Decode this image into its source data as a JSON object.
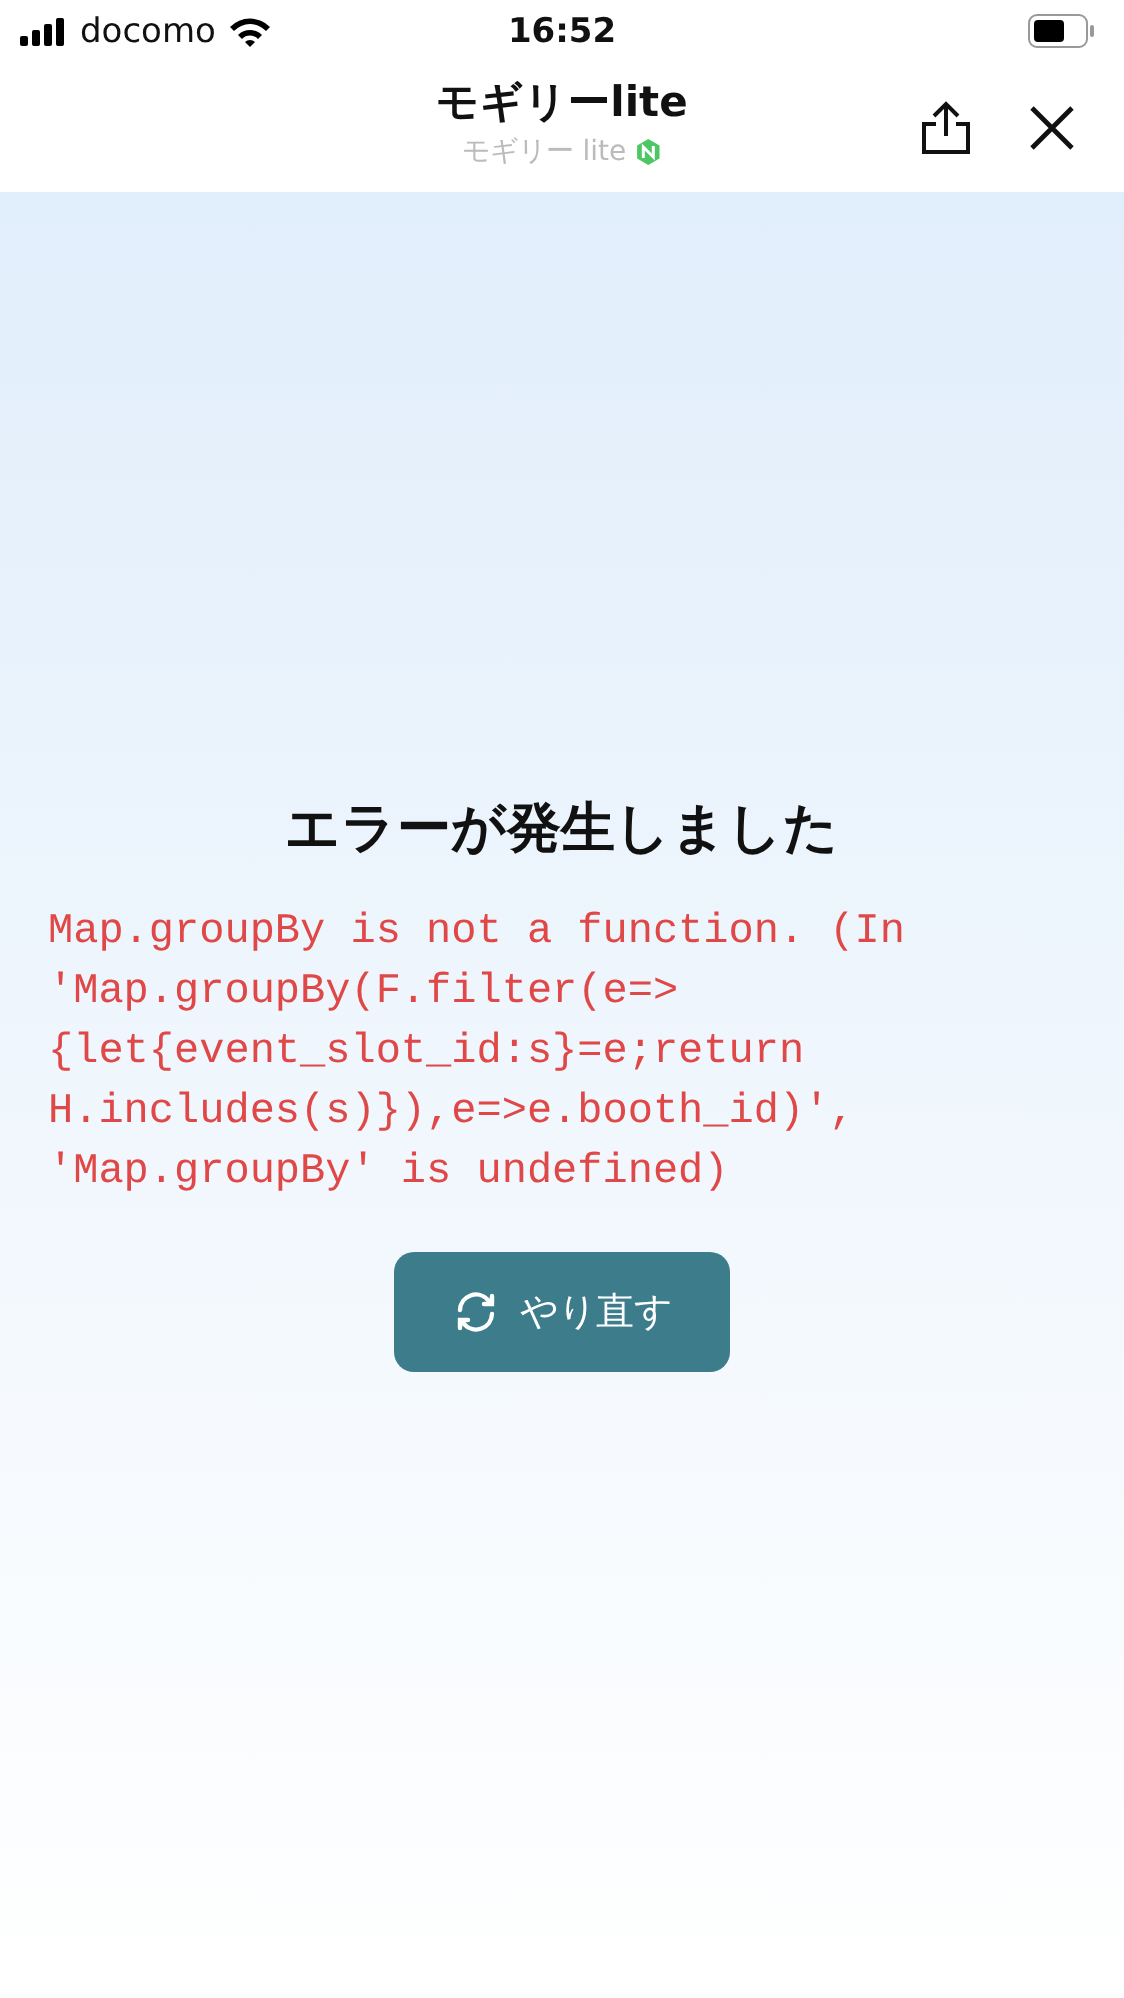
{
  "status_bar": {
    "carrier": "docomo",
    "time": "16:52"
  },
  "header": {
    "title": "モギリーlite",
    "subtitle": "モギリー lite"
  },
  "error": {
    "title": "エラーが発生しました",
    "message": "Map.groupBy is not a function. (In 'Map.groupBy(F.filter(e=>{let{event_slot_id:s}=e;return H.includes(s)}),e=>e.booth_id)', 'Map.groupBy' is undefined)",
    "button": "やり直す"
  }
}
